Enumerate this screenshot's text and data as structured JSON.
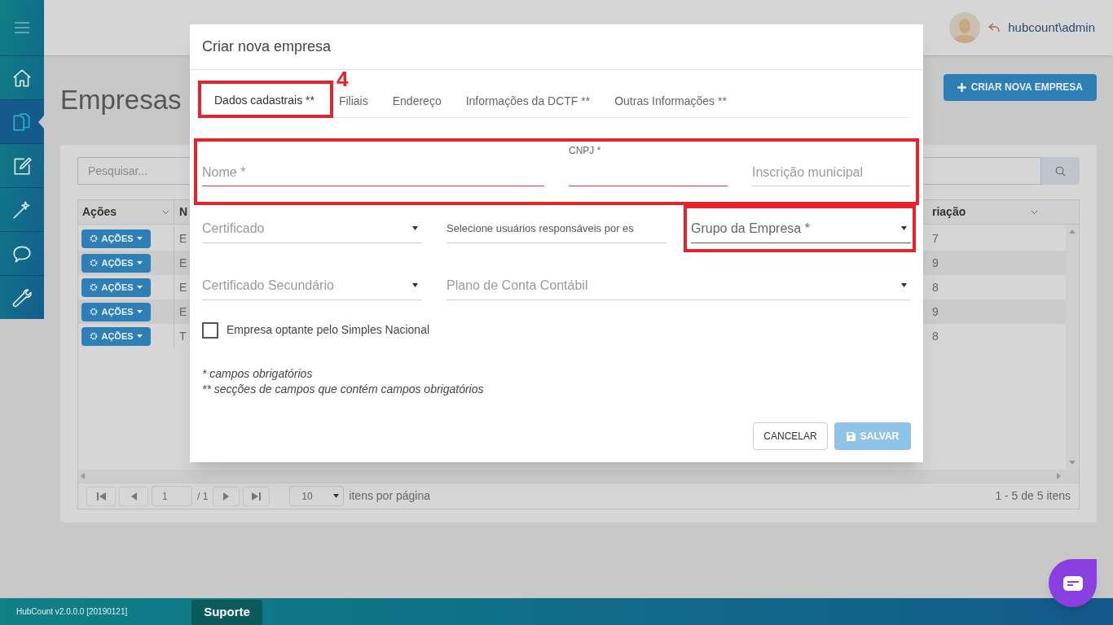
{
  "sidebar": {
    "items": [
      {
        "kind": "home",
        "selected": false
      },
      {
        "kind": "documents",
        "selected": true
      },
      {
        "kind": "edit",
        "selected": false
      },
      {
        "kind": "wand",
        "selected": false
      },
      {
        "kind": "chat",
        "selected": false
      },
      {
        "kind": "wrench",
        "selected": false
      }
    ]
  },
  "topbar": {
    "user": "hubcount\\admin"
  },
  "page": {
    "title": "Empresas",
    "create_button": "CRIAR NOVA EMPRESA"
  },
  "search": {
    "placeholder": "Pesquisar..."
  },
  "table": {
    "columns": [
      "Ações",
      "N",
      "riação"
    ],
    "rows": [
      {
        "action": "AÇÕES",
        "column_2": "E",
        "column_3": "7"
      },
      {
        "action": "AÇÕES",
        "column_2": "E",
        "column_3": "9"
      },
      {
        "action": "AÇÕES",
        "column_2": "E",
        "column_3": "8"
      },
      {
        "action": "AÇÕES",
        "column_2": "E",
        "column_3": "9"
      },
      {
        "action": "AÇÕES",
        "column_2": "T",
        "column_3": "8"
      }
    ]
  },
  "pager": {
    "page": "1",
    "of": "/ 1",
    "page_size": "10",
    "per_page_label": "itens por página",
    "summary": "1 - 5 de 5 itens"
  },
  "footer": {
    "version": "HubCount v2.0.0.0 [20190121]",
    "support_tab": "Suporte"
  },
  "modal": {
    "title": "Criar nova empresa",
    "tabs": [
      {
        "label": "Dados cadastrais **",
        "selected": true
      },
      {
        "label": "Filiais",
        "selected": false
      },
      {
        "label": "Endereço",
        "selected": false
      },
      {
        "label": "Informações da DCTF **",
        "selected": false
      },
      {
        "label": "Outras Informações **",
        "selected": false
      }
    ],
    "rows": [
      [
        {
          "kind": "text",
          "placeholder": "Nome *",
          "invalid": true,
          "focused": false
        },
        {
          "kind": "text",
          "label": "CNPJ *",
          "invalid": true,
          "focused": false
        },
        {
          "kind": "text",
          "placeholder": "Inscrição municipal",
          "invalid": false,
          "focused": false
        }
      ],
      [
        {
          "kind": "select",
          "placeholder": "Certificado",
          "invalid": false,
          "focused": false
        },
        {
          "kind": "multiselect",
          "placeholder": "Selecione usuários responsáveis por es",
          "invalid": false,
          "focused": false
        },
        {
          "kind": "select",
          "placeholder": "Grupo da Empresa *",
          "invalid": false,
          "focused": true
        }
      ],
      [
        {
          "kind": "select",
          "placeholder": "Certificado Secundário",
          "invalid": false,
          "focused": false
        },
        {
          "kind": "select",
          "placeholder": "Plano de Conta Contábil",
          "invalid": false,
          "focused": false
        }
      ]
    ],
    "checkbox": {
      "label": "Empresa optante pelo Simples Nacional",
      "checked": false
    },
    "notes": [
      "* campos obrigatórios",
      "** secções de campos que contém campos obrigatórios"
    ],
    "cancel_button": "CANCELAR",
    "save_button": {
      "label": "SALVAR",
      "disabled": true
    }
  },
  "annotation": {
    "number": "4"
  }
}
